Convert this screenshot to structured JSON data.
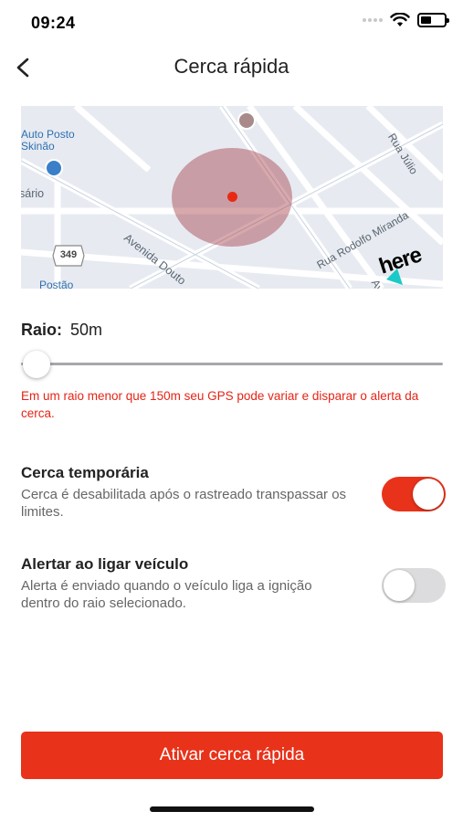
{
  "status_bar": {
    "time": "09:24",
    "icons": [
      "signal-dots-icon",
      "wifi-icon",
      "battery-icon"
    ]
  },
  "header": {
    "title": "Cerca rápida",
    "back_icon": "chevron-left-icon"
  },
  "map": {
    "labels": {
      "posto": "Auto Posto\nSkinão",
      "sario": "sário",
      "rua_julio": "Rua Júlio",
      "avenida_douto": "Avenida Douto",
      "rua_rodolfo": "Rua Rodolfo Miranda",
      "av_bottom": "Av",
      "posto_bottom": "Postão",
      "route_shield": "349",
      "brand": "here"
    },
    "fence_color": "#a0323c",
    "center_color": "#e82a14"
  },
  "radius": {
    "label": "Raio:",
    "value": "50m",
    "slider_fraction": 0.0,
    "warning": "Em um raio menor que 150m seu GPS pode variar e disparar o alerta da cerca."
  },
  "settings": {
    "temporary": {
      "title": "Cerca temporária",
      "description": "Cerca é desabilitada após o rastreado transpassar os limites.",
      "enabled": true
    },
    "ignition_alert": {
      "title": "Alertar ao ligar veículo",
      "description": "Alerta é enviado quando o veículo liga a ignição dentro do raio selecionado.",
      "enabled": false
    }
  },
  "action": {
    "button_label": "Ativar cerca rápida"
  },
  "colors": {
    "accent": "#e8321a",
    "warning_text": "#e52416",
    "toggle_off": "#dcdcde"
  }
}
